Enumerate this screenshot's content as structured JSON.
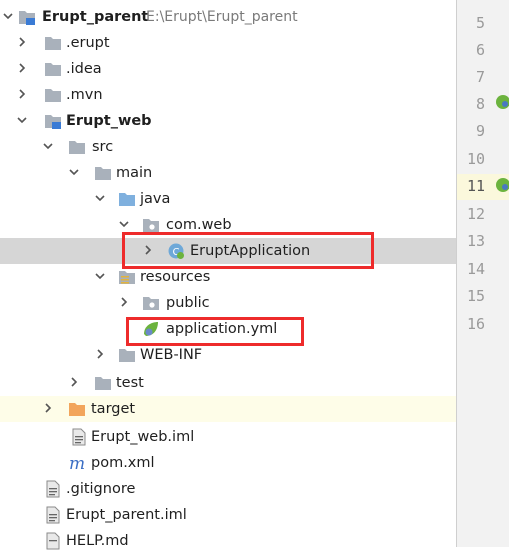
{
  "project_tree": {
    "root": {
      "label": "Erupt_parent",
      "path": "E:\\Erupt\\Erupt_parent"
    },
    "items": [
      {
        "label": ".erupt"
      },
      {
        "label": ".idea"
      },
      {
        "label": ".mvn"
      },
      {
        "label": "Erupt_web"
      },
      {
        "label": "src"
      },
      {
        "label": "main"
      },
      {
        "label": "java"
      },
      {
        "label": "com.web"
      },
      {
        "label": "EruptApplication"
      },
      {
        "label": "resources"
      },
      {
        "label": "public"
      },
      {
        "label": "application.yml"
      },
      {
        "label": "WEB-INF"
      },
      {
        "label": "test"
      },
      {
        "label": "target"
      },
      {
        "label": "Erupt_web.iml"
      },
      {
        "label": "pom.xml"
      },
      {
        "label": ".gitignore"
      },
      {
        "label": "Erupt_parent.iml"
      },
      {
        "label": "HELP.md"
      }
    ]
  },
  "editor": {
    "line_numbers": [
      "5",
      "6",
      "7",
      "8",
      "9",
      "10",
      "11",
      "12",
      "13",
      "14",
      "15",
      "16"
    ]
  },
  "colors": {
    "folder": "#a9b1bb",
    "source_folder": "#7fb0de",
    "excluded_folder": "#f2a55b",
    "spring_leaf": "#6cb33e",
    "highlight": "#ee2b2b",
    "maven_m": "#3b6ec4"
  }
}
